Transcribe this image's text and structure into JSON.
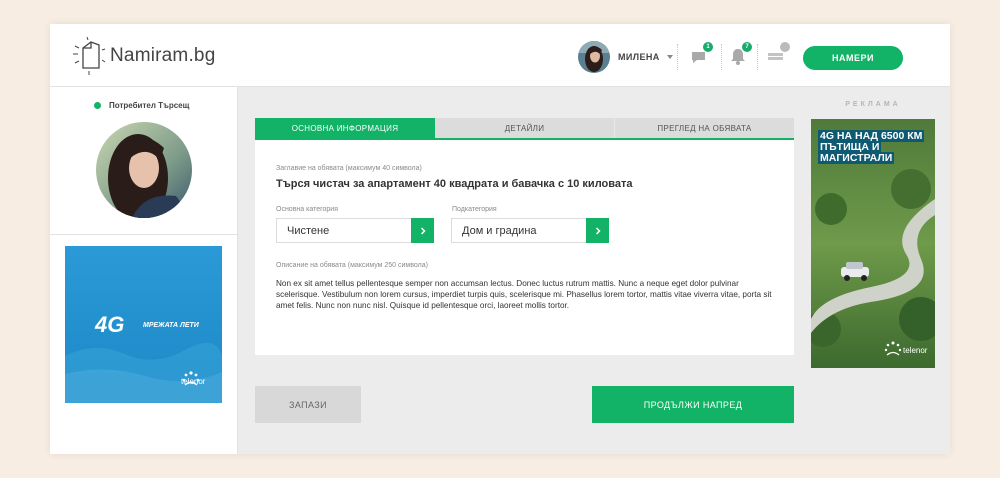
{
  "header": {
    "logo_text": "Namiram.bg",
    "user_name": "МИЛЕНА",
    "messages_badge": "1",
    "notifications_badge": "7",
    "find_button": "НАМЕРИ"
  },
  "sidebar": {
    "status_label": "Потребител Търсещ",
    "ad": {
      "main": "4G",
      "tagline": "МРЕЖАТА ЛЕТИ",
      "brand": "telenor"
    }
  },
  "tabs": [
    {
      "label": "ОСНОВНА ИНФОРМАЦИЯ",
      "active": true
    },
    {
      "label": "ДЕТАЙЛИ",
      "active": false
    },
    {
      "label": "ПРЕГЛЕД НА ОБЯВАТА",
      "active": false
    }
  ],
  "form": {
    "title_label": "Заглавие на обявата (максимум 40 символа)",
    "title_value": "Търся чистач за апартамент 40 квадрата и бавачка с 10 киловата",
    "category_label": "Основна категория",
    "category_value": "Чистене",
    "subcategory_label": "Подкатегория",
    "subcategory_value": "Дом и градина",
    "desc_label": "Описание на обявата (максимум 250 символа)",
    "desc_value": "Non ex sit amet tellus pellentesque semper non accumsan lectus. Donec luctus rutrum mattis. Nunc a neque eget dolor pulvinar scelerisque. Vestibulum non lorem cursus, imperdiet turpis quis, scelerisque mi. Phasellus lorem tortor, mattis vitae viverra vitae, porta sit amet felis. Nunc non nunc nisl. Quisque id pellentesque orci, laoreet mollis tortor."
  },
  "actions": {
    "save_label": "ЗАПАЗИ",
    "next_label": "ПРОДЪЛЖИ НАПРЕД"
  },
  "right_ad": {
    "label": "РЕКЛАМА",
    "headline": "4G НА НАД 6500 КМ ПЪТИЩА И МАГИСТРАЛИ",
    "brand": "telenor"
  },
  "colors": {
    "accent": "#12b267",
    "background": "#f7ede2",
    "panel_bg": "#ececec"
  }
}
